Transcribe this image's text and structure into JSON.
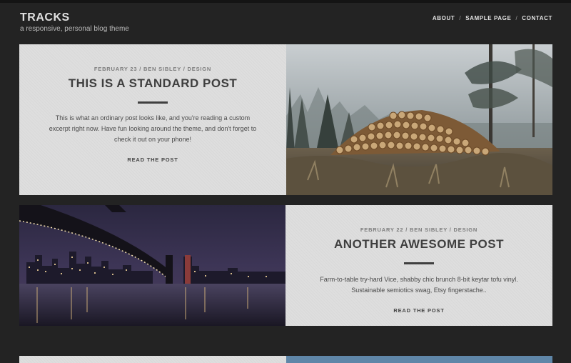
{
  "site": {
    "title": "TRACKS",
    "tagline": "a responsive, personal blog theme"
  },
  "nav": {
    "items": [
      "ABOUT",
      "SAMPLE PAGE",
      "CONTACT"
    ],
    "separator": "/"
  },
  "posts": [
    {
      "meta": "FEBRUARY 23 / BEN SIBLEY / DESIGN",
      "title": "THIS IS A STANDARD POST",
      "excerpt": "This is what an ordinary post looks like, and you're reading a custom excerpt right now. Have fun looking around the theme, and don't forget to check it out on your phone!",
      "read_more": "READ THE POST",
      "image": "log-pile-in-foggy-forest"
    },
    {
      "meta": "FEBRUARY 22 / BEN SIBLEY / DESIGN",
      "title": "ANOTHER AWESOME POST",
      "excerpt": "Farm-to-table try-hard Vice, shabby chic brunch 8-bit keytar tofu vinyl. Sustainable semiotics swag, Etsy fingerstache..",
      "read_more": "READ THE POST",
      "image": "bridge-over-river-city-night"
    }
  ],
  "colors": {
    "background": "#232323",
    "panel": "#dedede",
    "title_text": "#3f3f3f"
  }
}
